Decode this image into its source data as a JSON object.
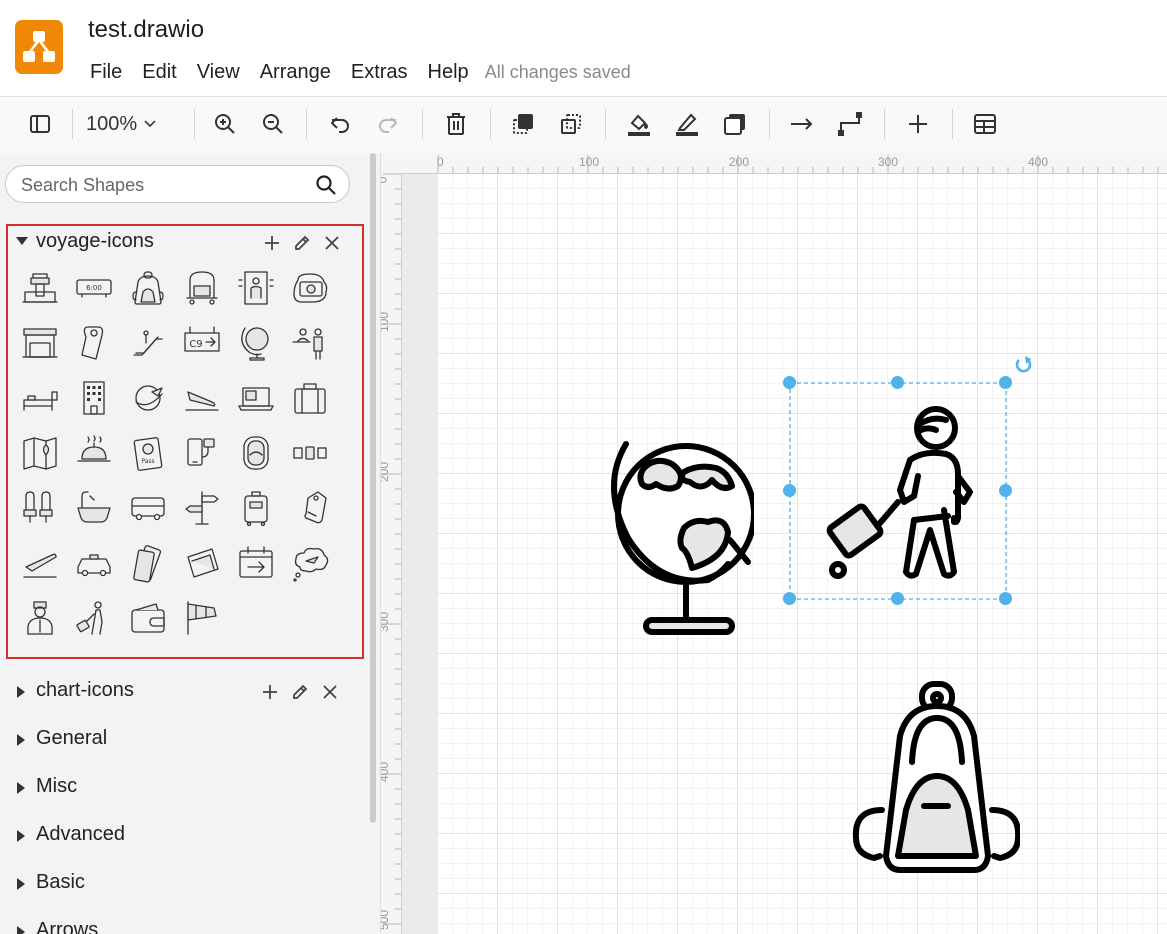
{
  "app": {
    "title": "test.drawio",
    "logo_icon": "drawio-logo-icon",
    "accent": "#f08705",
    "menu": [
      "File",
      "Edit",
      "View",
      "Arrange",
      "Extras",
      "Help"
    ],
    "save_status": "All changes saved"
  },
  "toolbar": {
    "zoom": "100%",
    "buttons": [
      "sidebar-toggle",
      "zoom-in",
      "zoom-out",
      "undo",
      "redo",
      "delete",
      "to-front",
      "to-back",
      "fill-color",
      "line-color",
      "shadow",
      "connection",
      "waypoints",
      "insert",
      "table"
    ]
  },
  "sidebar": {
    "search_placeholder": "Search Shapes",
    "open_library": {
      "title": "voyage-icons",
      "highlight_color": "#d32f2f",
      "icons": [
        "airport-tower",
        "departure-clock",
        "backpack",
        "luggage-cart",
        "security-gate",
        "camera",
        "check-in-desk",
        "door-hanger",
        "escalator",
        "gate-sign",
        "globe",
        "reception",
        "hotel-bed",
        "hotel-building",
        "airplane-globe",
        "airplane-landing",
        "laptop",
        "suitcase",
        "map",
        "room-service",
        "passport",
        "mobile-boarding",
        "airplane-window",
        "seat-belt",
        "airplane-seats",
        "bathtub",
        "bus",
        "signpost",
        "trolley-case",
        "luggage-tag",
        "airplane-takeoff",
        "taxi",
        "boarding-pass",
        "tickets",
        "calendar-arrow",
        "dream-trip",
        "bellboy",
        "traveler",
        "wallet",
        "windsock"
      ],
      "gate_label": "C9",
      "clock_label": "6:00",
      "passport_label": "Pass"
    },
    "sections": [
      "chart-icons",
      "General",
      "Misc",
      "Advanced",
      "Basic",
      "Arrows"
    ]
  },
  "rulers": {
    "top": [
      "0",
      "100",
      "200",
      "300",
      "400"
    ],
    "left": [
      "0",
      "100",
      "200",
      "300",
      "400",
      "500"
    ]
  },
  "canvas": {
    "shapes": [
      "globe",
      "traveler",
      "backpack"
    ],
    "selected": "traveler",
    "selection_color": "#4fb3ea",
    "icon_fill": "#e6e6e6"
  }
}
